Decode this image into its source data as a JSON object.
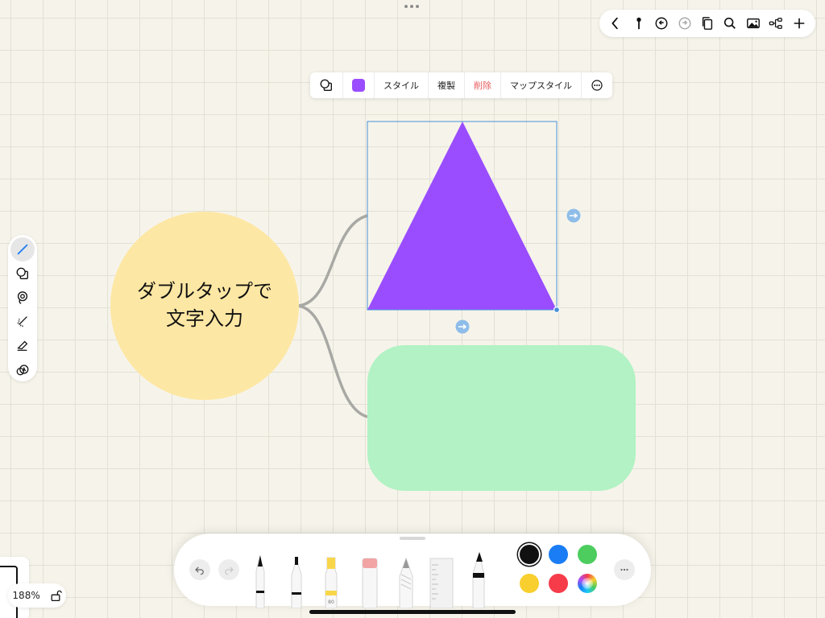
{
  "top_toolbar": {
    "icons": [
      "back-icon",
      "pin-icon",
      "undo-icon",
      "redo-icon",
      "copy-icon",
      "search-icon",
      "image-icon",
      "mindmap-icon",
      "add-icon"
    ]
  },
  "context_menu": {
    "items": [
      "スタイル",
      "複製",
      "削除",
      "マップスタイル"
    ],
    "swatch_color": "#9a4dff",
    "danger_color": "#e85c5c"
  },
  "left_tools": [
    "pen-icon",
    "shapes-icon",
    "lasso-icon",
    "laser-pointer-icon",
    "eraser-icon",
    "shape-recognition-icon"
  ],
  "canvas": {
    "central_node": {
      "lines": [
        "ダブルタップで",
        "文字入力"
      ],
      "color": "#fde7a4"
    },
    "triangle_color": "#9a4dff",
    "rect_color": "#b2f2c4",
    "connector_color": "#a8a8a4",
    "selection_color": "#4a90d9"
  },
  "bottom_toolbar": {
    "tools": [
      "fountain-pen-icon",
      "fineliner-icon",
      "highlighter-icon",
      "eraser-icon",
      "pencil-icon",
      "ruler-icon",
      "marker-icon"
    ],
    "highlighter_label": "80",
    "colors": [
      "#111111",
      "#1a7df5",
      "#4ccd5e",
      "#f8cf2e",
      "#f63b4a"
    ],
    "selected_color_index": 0
  },
  "zoom": {
    "level": "188%"
  }
}
